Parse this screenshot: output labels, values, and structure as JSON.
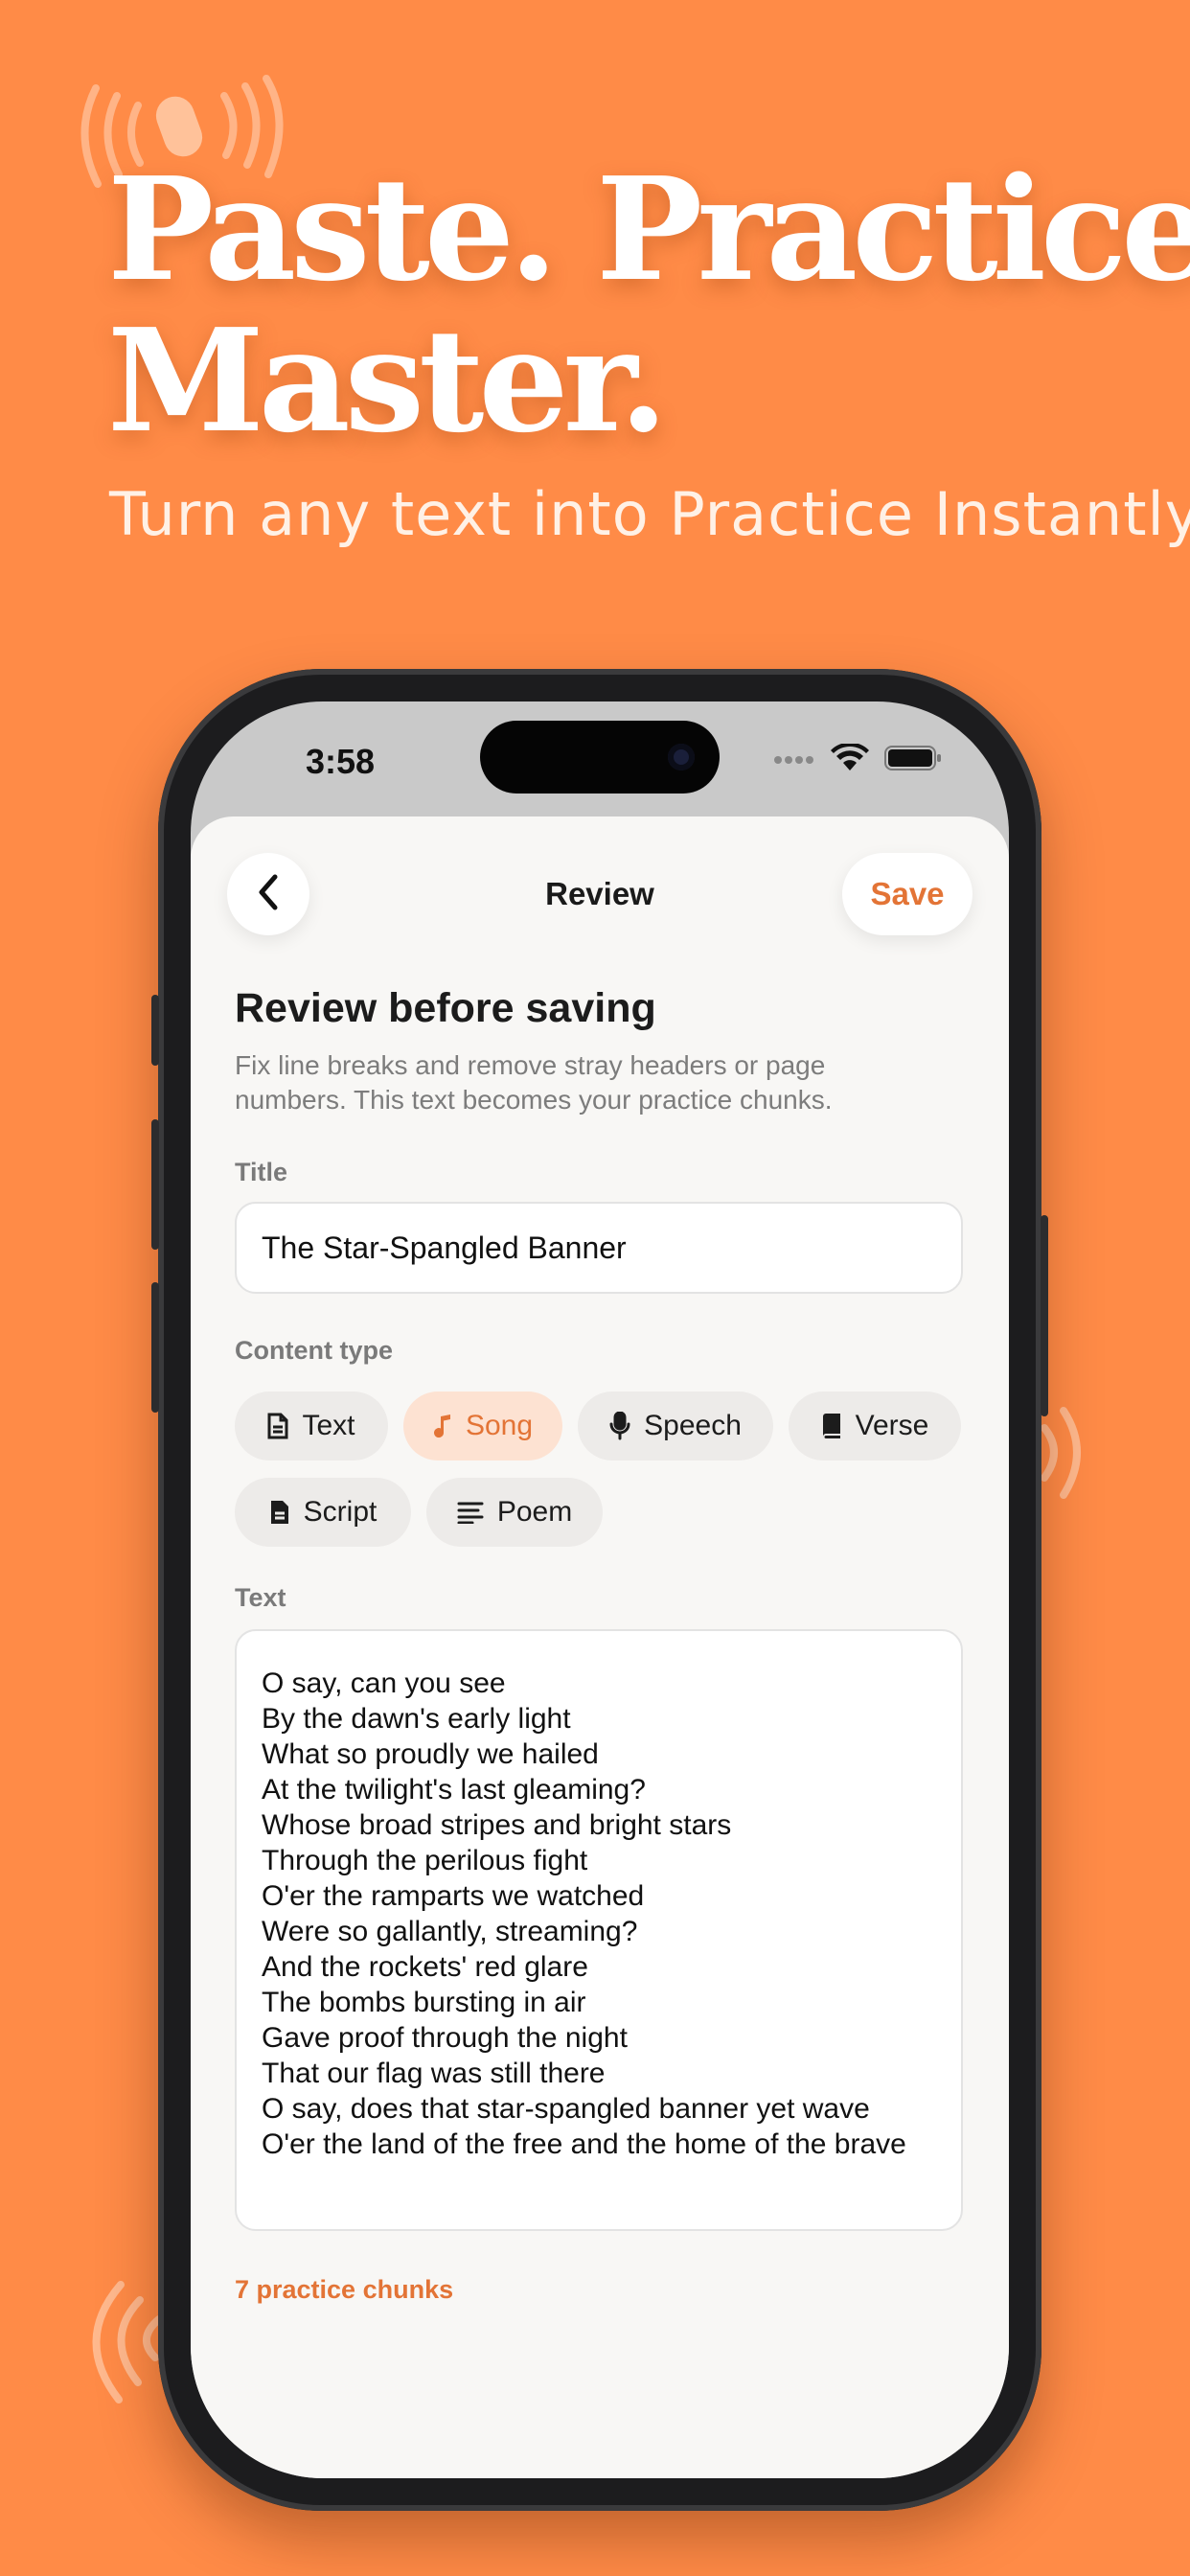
{
  "hero": {
    "headline_line1": "Paste. Practice.",
    "headline_line2": "Master.",
    "subheadline": "Turn any text into Practice Instantly"
  },
  "status_bar": {
    "time": "3:58"
  },
  "nav": {
    "title": "Review",
    "save_label": "Save",
    "back_icon": "chevron-left-icon"
  },
  "form": {
    "heading": "Review before saving",
    "description": "Fix line breaks and remove stray headers or page numbers. This text becomes your practice chunks.",
    "title_label": "Title",
    "title_value": "The Star-Spangled Banner",
    "content_type_label": "Content type",
    "content_types": [
      {
        "label": "Text",
        "icon": "document-icon",
        "selected": false
      },
      {
        "label": "Song",
        "icon": "music-note-icon",
        "selected": true
      },
      {
        "label": "Speech",
        "icon": "microphone-icon",
        "selected": false
      },
      {
        "label": "Verse",
        "icon": "book-icon",
        "selected": false
      },
      {
        "label": "Script",
        "icon": "script-icon",
        "selected": false
      },
      {
        "label": "Poem",
        "icon": "lines-icon",
        "selected": false
      }
    ],
    "text_label": "Text",
    "text_lines": [
      "O say, can you see",
      "By the dawn's early light",
      "What so proudly we hailed",
      "At the twilight's last gleaming?",
      "Whose broad stripes and bright stars",
      "Through the perilous fight",
      "O'er the ramparts we watched",
      "Were so gallantly, streaming?",
      "And the rockets' red glare",
      "The bombs bursting in air",
      "Gave proof through the night",
      "That our flag was still there",
      "O say, does that star-spangled banner yet wave",
      "O'er the land of the free and the home of the brave"
    ],
    "chunk_count": "7 practice chunks"
  },
  "colors": {
    "background": "#FF8B47",
    "accent": "#E37436",
    "selected_chip": "#FDE2D2"
  }
}
